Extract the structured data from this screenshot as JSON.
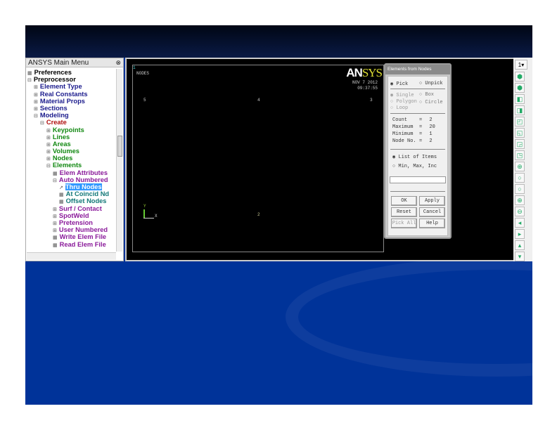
{
  "menu": {
    "title": "ANSYS Main Menu",
    "items": [
      {
        "label": "Preferences",
        "level": 0,
        "box": "▦",
        "color": "#000"
      },
      {
        "label": "Preprocessor",
        "level": 0,
        "box": "⊟",
        "color": "#000"
      },
      {
        "label": "Element Type",
        "level": 1,
        "box": "⊞",
        "color": "#1a1a8c"
      },
      {
        "label": "Real Constants",
        "level": 1,
        "box": "⊞",
        "color": "#1a1a8c"
      },
      {
        "label": "Material Props",
        "level": 1,
        "box": "⊞",
        "color": "#1a1a8c"
      },
      {
        "label": "Sections",
        "level": 1,
        "box": "⊞",
        "color": "#1a1a8c"
      },
      {
        "label": "Modeling",
        "level": 1,
        "box": "⊟",
        "color": "#1a1a8c"
      },
      {
        "label": "Create",
        "level": 2,
        "box": "⊟",
        "color": "#b01010"
      },
      {
        "label": "Keypoints",
        "level": 3,
        "box": "⊞",
        "color": "#118811"
      },
      {
        "label": "Lines",
        "level": 3,
        "box": "⊞",
        "color": "#118811"
      },
      {
        "label": "Areas",
        "level": 3,
        "box": "⊞",
        "color": "#118811"
      },
      {
        "label": "Volumes",
        "level": 3,
        "box": "⊞",
        "color": "#118811"
      },
      {
        "label": "Nodes",
        "level": 3,
        "box": "⊞",
        "color": "#118811"
      },
      {
        "label": "Elements",
        "level": 3,
        "box": "⊟",
        "color": "#118811"
      },
      {
        "label": "Elem Attributes",
        "level": 4,
        "box": "▦",
        "color": "#8a1a9a"
      },
      {
        "label": "Auto Numbered",
        "level": 4,
        "box": "⊟",
        "color": "#8a1a9a"
      },
      {
        "label": "Thru Nodes",
        "level": 5,
        "box": "↗",
        "color": "#fff",
        "selected": true
      },
      {
        "label": "At Coincid Nd",
        "level": 5,
        "box": "▦",
        "color": "#117777"
      },
      {
        "label": "Offset Nodes",
        "level": 5,
        "box": "▦",
        "color": "#117777"
      },
      {
        "label": "Surf / Contact",
        "level": 4,
        "box": "⊞",
        "color": "#8a1a9a"
      },
      {
        "label": "SpotWeld",
        "level": 4,
        "box": "⊞",
        "color": "#8a1a9a"
      },
      {
        "label": "Pretension",
        "level": 4,
        "box": "⊞",
        "color": "#8a1a9a"
      },
      {
        "label": "User Numbered",
        "level": 4,
        "box": "⊞",
        "color": "#8a1a9a"
      },
      {
        "label": "Write Elem File",
        "level": 4,
        "box": "▦",
        "color": "#8a1a9a"
      },
      {
        "label": "Read Elem File",
        "level": 4,
        "box": "▦",
        "color": "#8a1a9a"
      }
    ]
  },
  "graphics": {
    "window_num": "1",
    "plot_label": "NODES",
    "logo_a": "AN",
    "logo_b": "SYS",
    "date": "NOV  7 2012",
    "time": "09:37:55",
    "nodes": [
      "5",
      "4",
      "3",
      "2"
    ],
    "axis_x": "X",
    "axis_y": "Y"
  },
  "dialog": {
    "title": "Elements from Nodes",
    "pick": "Pick",
    "unpick": "Unpick",
    "single": "Single",
    "box": "Box",
    "polygon": "Polygon",
    "circle": "Circle",
    "loop": "Loop",
    "stats": [
      {
        "k": "Count",
        "v": "2"
      },
      {
        "k": "Maximum",
        "v": "20"
      },
      {
        "k": "Minimum",
        "v": "1"
      },
      {
        "k": "Node No.",
        "v": "2"
      }
    ],
    "list_items": "List of Items",
    "min_max_inc": "Min, Max, Inc",
    "input_value": "",
    "ok": "OK",
    "apply": "Apply",
    "reset": "Reset",
    "cancel": "Cancel",
    "pick_all": "Pick All",
    "help": "Help"
  },
  "toolbar": {
    "window_select": "1",
    "icons": [
      "iso-view-icon",
      "oblique-view-icon",
      "front-view-icon",
      "back-view-icon",
      "top-view-icon",
      "bottom-view-icon",
      "left-view-icon",
      "right-view-icon",
      "zoom-icon",
      "zoom-box-icon",
      "zoom-back-icon",
      "zoom-in-icon",
      "zoom-out-icon",
      "pan-left-icon",
      "pan-right-icon",
      "pan-up-icon",
      "pan-down-icon"
    ]
  }
}
